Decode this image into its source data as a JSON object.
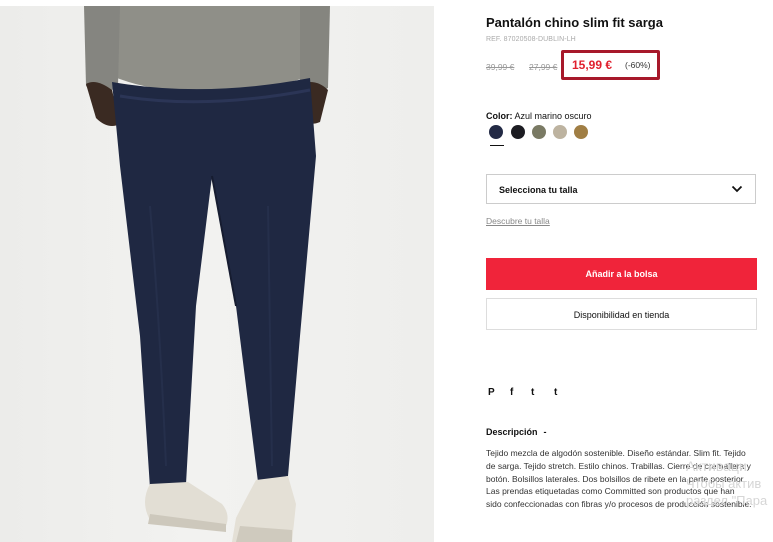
{
  "product": {
    "title": "Pantalón chino slim fit sarga",
    "ref": "REF. 87020508-DUBLIN-LH",
    "price_original": "39,99 €",
    "price_previous": "27,99 €",
    "price_current": "15,99 €",
    "discount": "(-60%)",
    "color_label": "Color:",
    "color_value": "Azul marino oscuro",
    "swatches": [
      {
        "name": "Azul marino oscuro",
        "color": "#232a45",
        "selected": true
      },
      {
        "name": "negro",
        "color": "#1c1c22"
      },
      {
        "name": "kaki",
        "color": "#7a7a64"
      },
      {
        "name": "beige",
        "color": "#bdb3a0"
      },
      {
        "name": "camel",
        "color": "#a07e44"
      }
    ],
    "size_select": "Selecciona tu talla",
    "size_guide": "Descubre tu talla",
    "add_to_bag": "Añadir a la bolsa",
    "store_availability": "Disponibilidad en tienda",
    "share_icons": [
      "pinterest-icon",
      "facebook-icon",
      "twitter-icon",
      "tumblr-icon"
    ],
    "share_glyphs": {
      "pinterest": "P",
      "facebook": "f",
      "twitter": "t",
      "tumblr": "t"
    },
    "description_title": "Descripción",
    "description_toggle": "-",
    "description": "Tejido mezcla de algodón sostenible. Diseño estándar. Slim fit. Tejido de sarga. Tejido stretch. Estilo chinos. Trabillas. Cierre de cremallera y botón. Bolsillos laterales. Dos bolsillos de ribete en la parte posterior. Las prendas etiquetadas como Committed son productos que han sido confeccionadas con fibras y/o procesos de producción sostenible."
  },
  "watermark": {
    "line1": "Активаци",
    "line2": "Чтобы актив",
    "line3": "раздел \"Пара"
  },
  "colors": {
    "accent_red": "#f0243a",
    "price_red": "#e0202e",
    "highlight_border": "#a7182a"
  }
}
